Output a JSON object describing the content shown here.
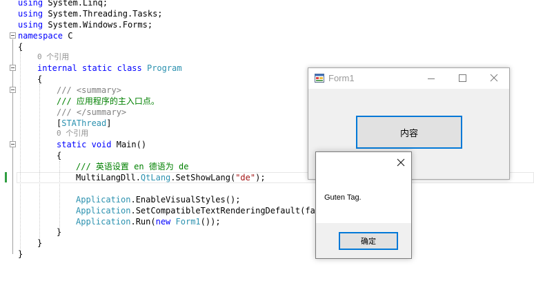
{
  "editor": {
    "l1": {
      "kw": "using",
      "rest": " System.Linq;"
    },
    "l2": {
      "kw": "using",
      "rest": " System.Threading.Tasks;"
    },
    "l3": {
      "kw": "using",
      "rest": " System.Windows.Forms;"
    },
    "l4": {
      "kw": "namespace",
      "rest": " C"
    },
    "l5": "{",
    "l6": "0 个引用",
    "l7": {
      "kw1": "internal",
      "kw2": "static",
      "kw3": "class",
      "cls": "Program"
    },
    "l8": "{",
    "l9": {
      "prefix": "///",
      "tag": " <summary>"
    },
    "l10": "/// 应用程序的主入口点。",
    "l11": {
      "open": "[",
      "attr": "STAThread",
      "close": "]"
    },
    "l12": "0 个引用",
    "l13": {
      "kw1": "static",
      "kw2": "void",
      "rest": " Main()"
    },
    "l14": "{",
    "l15": "/// 英语设置 en 德语为 de",
    "l16": {
      "a": "MultiLangDll.",
      "b": "QtLang",
      "c": ".SetShowLang(",
      "s": "\"de\"",
      "d": ");"
    },
    "l17": {
      "cls": "Application",
      "rest": ".EnableVisualStyles();"
    },
    "l18": {
      "cls": "Application",
      "rest": ".SetCompatibleTextRenderingDefault(fals"
    },
    "l19": {
      "cls": "Application",
      "a": ".Run(",
      "kw": "new",
      "b": " ",
      "form": "Form1",
      "c": "());"
    },
    "l20": "}",
    "l21": "}",
    "l22": "}",
    "l23": {
      "prefix": "///",
      "tag": " </summary>"
    }
  },
  "form1": {
    "title": "Form1",
    "button_label": "内容"
  },
  "messagebox": {
    "message": "Guten Tag.",
    "ok_label": "确定"
  }
}
